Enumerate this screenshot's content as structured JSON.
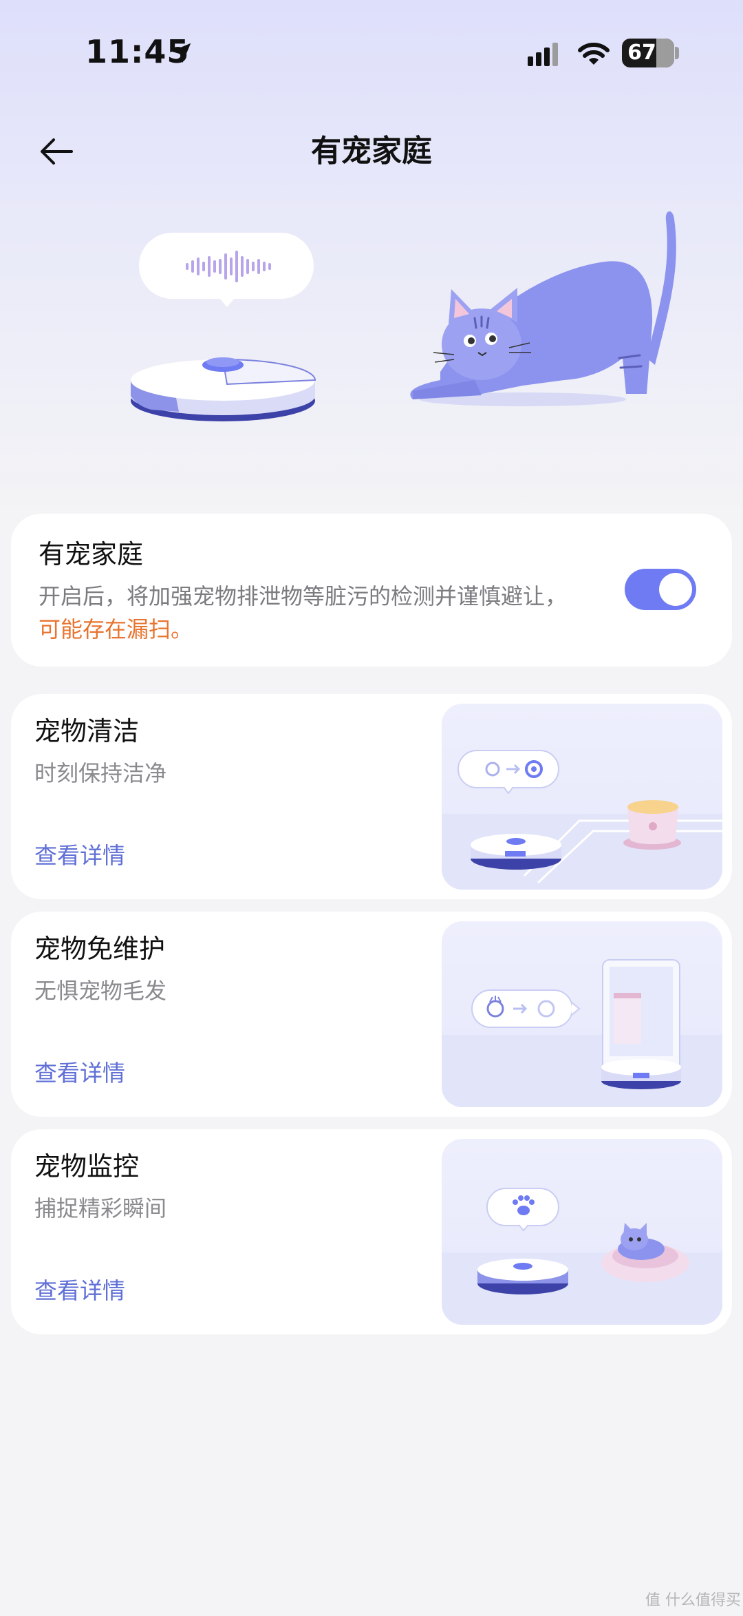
{
  "status_bar": {
    "time": "11:45",
    "battery": "67"
  },
  "header": {
    "title": "有宠家庭"
  },
  "toggle_card": {
    "title": "有宠家庭",
    "desc_main": "开启后，将加强宠物排泄物等脏污的检测并谨慎避让，",
    "desc_warn": "可能存在漏扫。",
    "enabled": true
  },
  "features": [
    {
      "title": "宠物清洁",
      "subtitle": "时刻保持洁净",
      "link": "查看详情"
    },
    {
      "title": "宠物免维护",
      "subtitle": "无惧宠物毛发",
      "link": "查看详情"
    },
    {
      "title": "宠物监控",
      "subtitle": "捕捉精彩瞬间",
      "link": "查看详情"
    }
  ],
  "watermark": "值 什么值得买",
  "colors": {
    "accent": "#6e7bf2",
    "link": "#5f6fd6",
    "warning": "#e8742f"
  }
}
